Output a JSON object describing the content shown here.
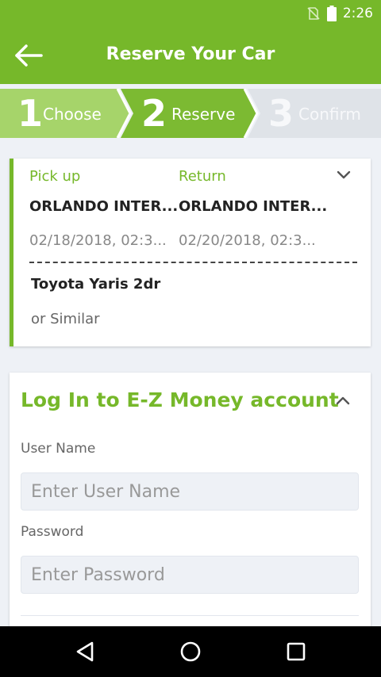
{
  "status_bar": {
    "time": "2:26"
  },
  "app_bar": {
    "title": "Reserve Your Car"
  },
  "steps": [
    {
      "number": "1",
      "label": "Choose"
    },
    {
      "number": "2",
      "label": "Reserve"
    },
    {
      "number": "3",
      "label": "Confirm"
    }
  ],
  "trip": {
    "pickup_label": "Pick up",
    "return_label": "Return",
    "pickup_location": "ORLANDO INTER...",
    "return_location": "ORLANDO INTER...",
    "pickup_datetime": "02/18/2018, 02:3...",
    "return_datetime": "02/20/2018, 02:3...",
    "car_name": "Toyota Yaris 2dr",
    "car_sub": "or Similar"
  },
  "login": {
    "title": "Log In to E-Z Money account",
    "username_label": "User Name",
    "username_placeholder": "Enter User Name",
    "password_label": "Password",
    "password_placeholder": "Enter Password"
  },
  "colors": {
    "brand_green": "#76b82a",
    "step_light_green": "#a6d46a",
    "step_inactive": "#dfe3e8"
  },
  "icons": {
    "back": "arrow-left-icon",
    "trip_expand": "chevron-down-icon",
    "login_collapse": "chevron-up-icon",
    "nav_back": "triangle-back-icon",
    "nav_home": "circle-home-icon",
    "nav_recents": "square-recents-icon"
  }
}
